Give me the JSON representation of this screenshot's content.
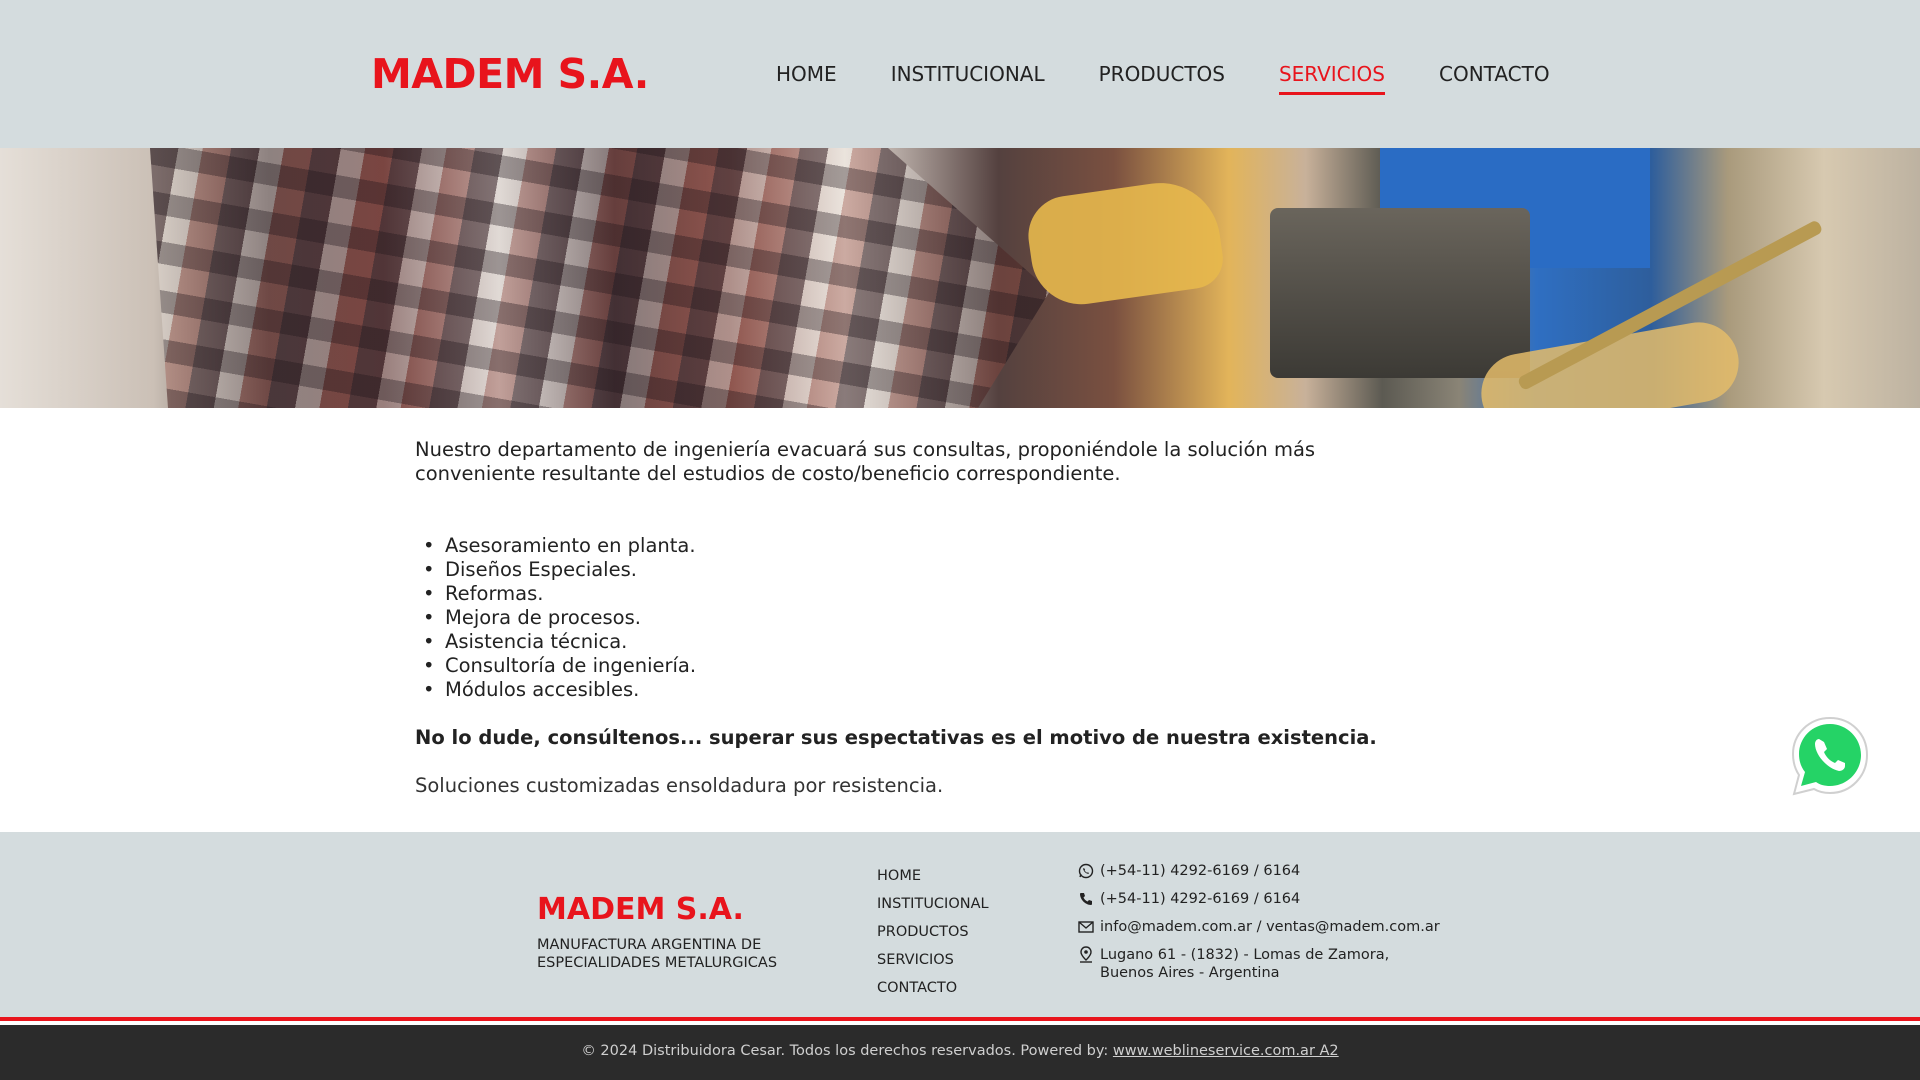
{
  "header": {
    "logo": "MADEM S.A.",
    "nav": [
      {
        "label": "HOME",
        "active": false
      },
      {
        "label": "INSTITUCIONAL",
        "active": false
      },
      {
        "label": "PRODUCTOS",
        "active": false
      },
      {
        "label": "SERVICIOS",
        "active": true
      },
      {
        "label": "CONTACTO",
        "active": false
      }
    ]
  },
  "main": {
    "intro": "Nuestro departamento de ingeniería evacuará sus consultas, proponiéndole la solución más conveniente resultante del estudios de costo/beneficio correspondiente.",
    "services": [
      "Asesoramiento en planta.",
      "Diseños Especiales.",
      "Reformas.",
      "Mejora de procesos.",
      "Asistencia técnica.",
      "Consultoría de ingeniería.",
      "Módulos accesibles."
    ],
    "highlight": "No lo dude, consúltenos... superar sus espectativas es el motivo de nuestra existencia.",
    "closing": "Soluciones customizadas ensoldadura por resistencia."
  },
  "whatsapp": {
    "icon": "whatsapp-icon"
  },
  "footer": {
    "logo": "MADEM S.A.",
    "tagline_1": "MANUFACTURA ARGENTINA DE",
    "tagline_2": "ESPECIALIDADES METALURGICAS",
    "nav": [
      "HOME",
      "INSTITUCIONAL",
      "PRODUCTOS",
      "SERVICIOS",
      "CONTACTO"
    ],
    "contact": {
      "whatsapp": "(+54-11) 4292-6169 / 6164",
      "phone": "(+54-11) 4292-6169 / 6164",
      "email": "info@madem.com.ar / ventas@madem.com.ar",
      "address_1": "Lugano 61 - (1832) - Lomas de Zamora,",
      "address_2": "Buenos Aires - Argentina"
    }
  },
  "bottom": {
    "copyright": "© 2024 Distribuidora Cesar. Todos los derechos reservados. Powered by: ",
    "link": "www.weblineservice.com.ar A2"
  },
  "colors": {
    "brand_red": "#e8141c",
    "header_bg": "#d4dcde",
    "bottom_bar": "#2b2b2b",
    "whatsapp_green": "#25d366"
  }
}
